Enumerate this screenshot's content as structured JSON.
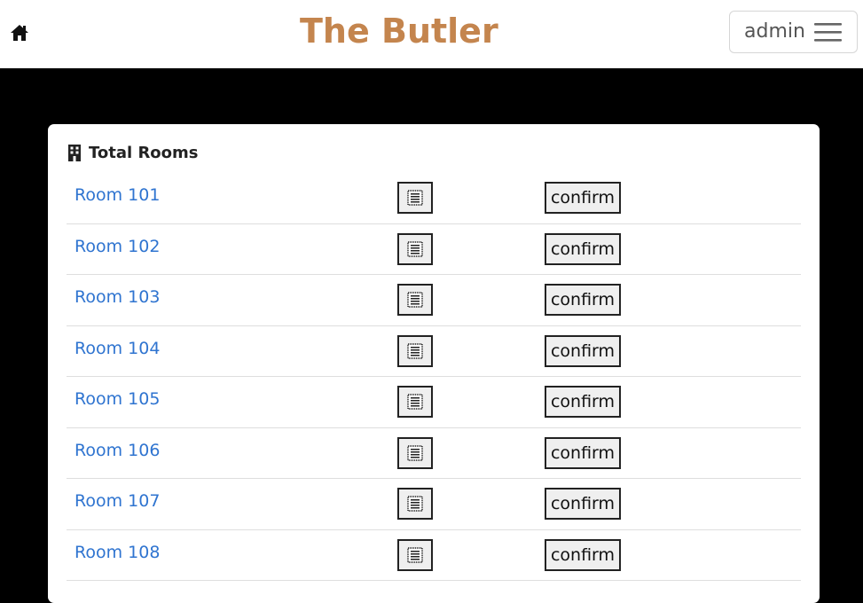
{
  "header": {
    "brand": "The Butler",
    "home_icon": "home-icon",
    "user": "admin",
    "menu_icon": "hamburger-icon",
    "brand_color": "#c4854e"
  },
  "card": {
    "title": "Total Rooms",
    "title_icon": "building-icon",
    "rooms": [
      {
        "name": "Room 101",
        "action": "confirm"
      },
      {
        "name": "Room 102",
        "action": "confirm"
      },
      {
        "name": "Room 103",
        "action": "confirm"
      },
      {
        "name": "Room 104",
        "action": "confirm"
      },
      {
        "name": "Room 105",
        "action": "confirm"
      },
      {
        "name": "Room 106",
        "action": "confirm"
      },
      {
        "name": "Room 107",
        "action": "confirm"
      },
      {
        "name": "Room 108",
        "action": "confirm"
      }
    ],
    "link_color": "#2f74d0"
  }
}
